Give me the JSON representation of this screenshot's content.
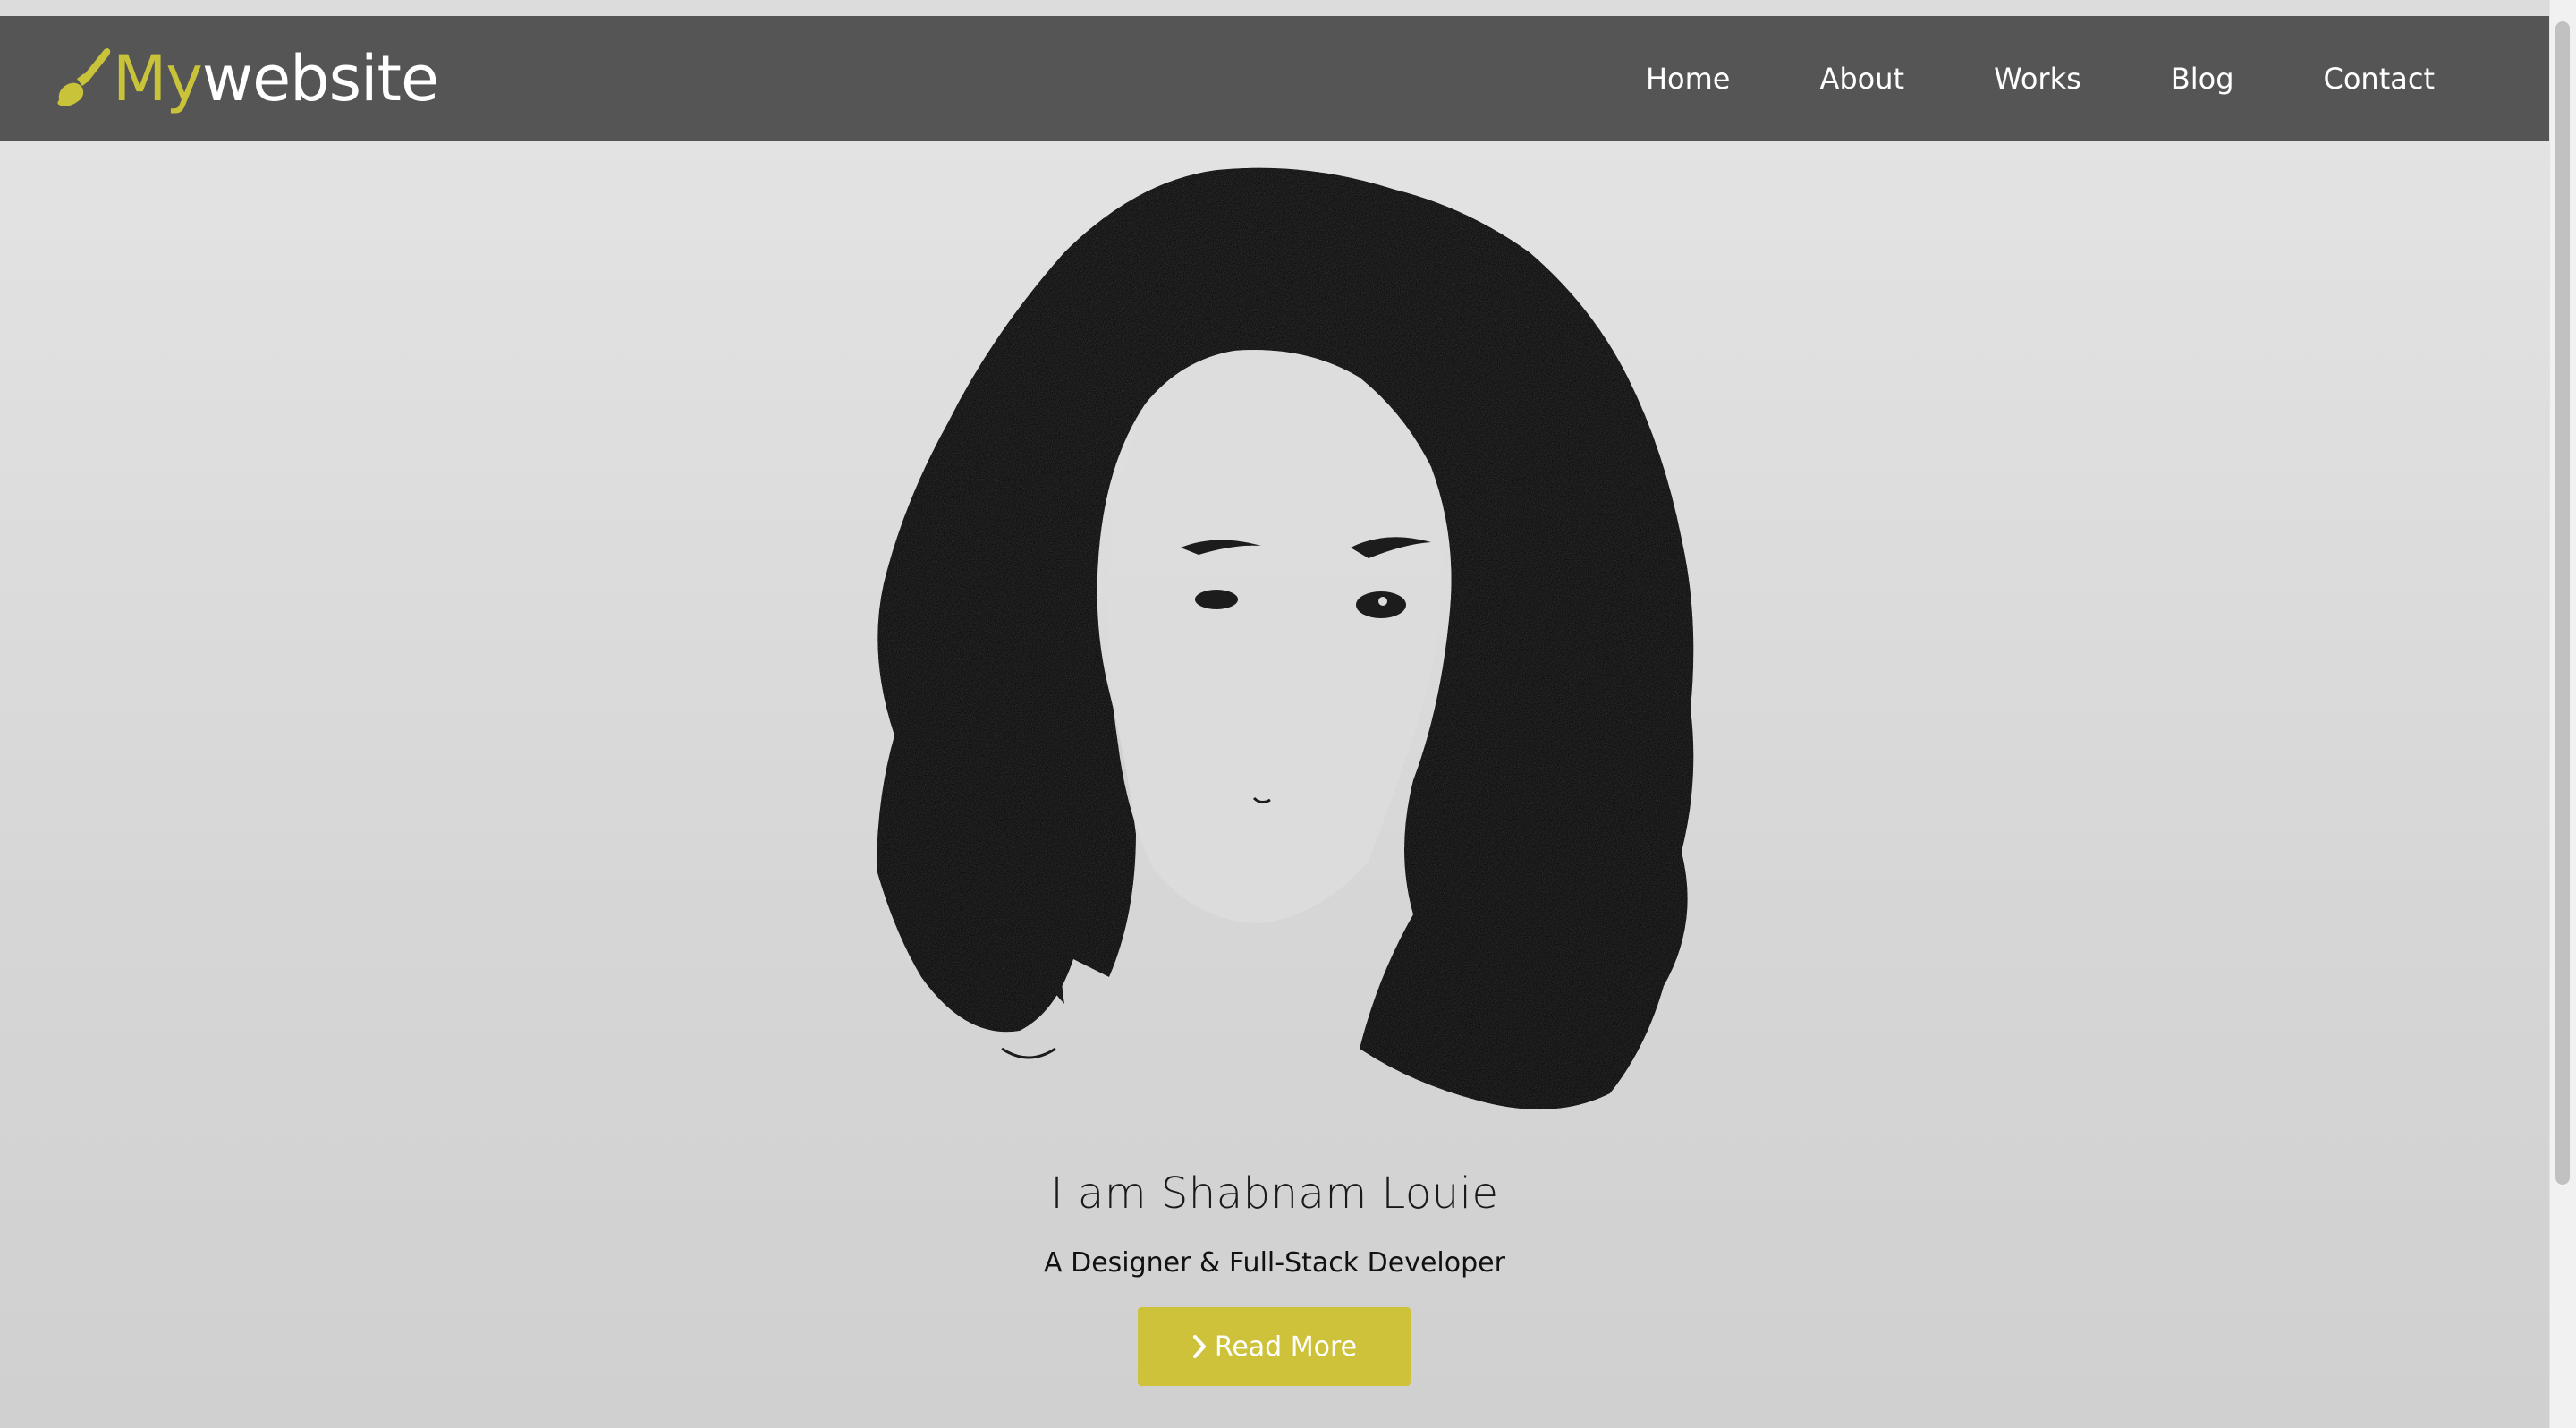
{
  "brand": {
    "part1": "My",
    "part2": "website",
    "icon": "paint-brush-icon",
    "accent_color": "#c9c33a"
  },
  "nav": {
    "items": [
      {
        "label": "Home"
      },
      {
        "label": "About"
      },
      {
        "label": "Works"
      },
      {
        "label": "Blog"
      },
      {
        "label": "Contact"
      }
    ]
  },
  "hero": {
    "title": "I am Shabnam Louie",
    "subtitle": "A Designer & Full-Stack Developer",
    "button_label": "Read More",
    "button_icon": "chevron-right-icon",
    "button_color": "#cdc23a"
  },
  "colors": {
    "navbar": "#555555",
    "hero_background": "#d6d6d6"
  }
}
